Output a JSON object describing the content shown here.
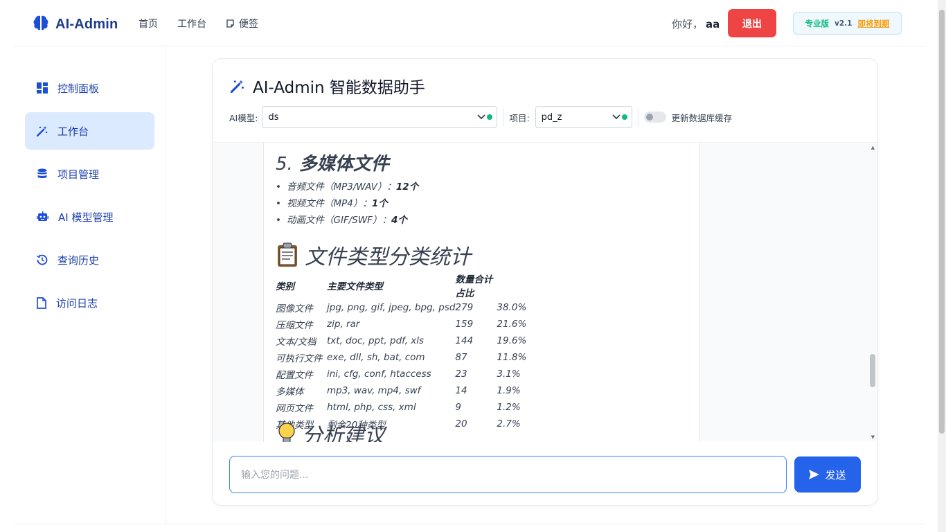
{
  "header": {
    "logo": "AI-Admin",
    "nav": [
      {
        "label": "首页"
      },
      {
        "label": "工作台"
      },
      {
        "label": "便签"
      }
    ],
    "greeting": "你好，",
    "username": "aa",
    "logout": "退出",
    "edition": "专业版",
    "version": "v2.1",
    "expiry": "即将到期"
  },
  "sidebar": {
    "items": [
      {
        "label": "控制面板"
      },
      {
        "label": "工作台"
      },
      {
        "label": "项目管理"
      },
      {
        "label": "AI 模型管理"
      },
      {
        "label": "查询历史"
      },
      {
        "label": "访问日志"
      }
    ]
  },
  "card": {
    "title": "AI-Admin 智能数据助手",
    "model_label": "AI模型:",
    "model_value": "ds",
    "project_label": "项目:",
    "project_value": "pd_z",
    "cache_label": "更新数据库缓存"
  },
  "message": {
    "section_num": "5.",
    "section_title": "多媒体文件",
    "items": [
      {
        "text": "音频文件（MP3/WAV）：",
        "count": "12个"
      },
      {
        "text": "视频文件（MP4）：",
        "count": "1个"
      },
      {
        "text": "动画文件（GIF/SWF）：",
        "count": "4个"
      }
    ],
    "stats_title": "文件类型分类统计",
    "table_headers": [
      "类别",
      "主要文件类型",
      "数量",
      "合计占比"
    ],
    "rows": [
      [
        "图像文件",
        "jpg, png, gif, jpeg, bpg, psd",
        "279",
        "38.0%"
      ],
      [
        "压缩文件",
        "zip, rar",
        "159",
        "21.6%"
      ],
      [
        "文本/文档",
        "txt, doc, ppt, pdf, xls",
        "144",
        "19.6%"
      ],
      [
        "可执行文件",
        "exe, dll, sh, bat, com",
        "87",
        "11.8%"
      ],
      [
        "配置文件",
        "ini, cfg, conf, htaccess",
        "23",
        "3.1%"
      ],
      [
        "多媒体",
        "mp3, wav, mp4, swf",
        "14",
        "1.9%"
      ],
      [
        "网页文件",
        "html, php, css, xml",
        "9",
        "1.2%"
      ],
      [
        "其他类型",
        "剩余20种类型",
        "20",
        "2.7%"
      ]
    ],
    "analysis_title": "分析建议"
  },
  "input": {
    "placeholder": "输入您的问题...",
    "send": "发送"
  },
  "colors": {
    "brand": "#1e3a8a",
    "accent": "#2563eb",
    "danger": "#ef4444",
    "success": "#10b981",
    "warning": "#f59e0b"
  }
}
